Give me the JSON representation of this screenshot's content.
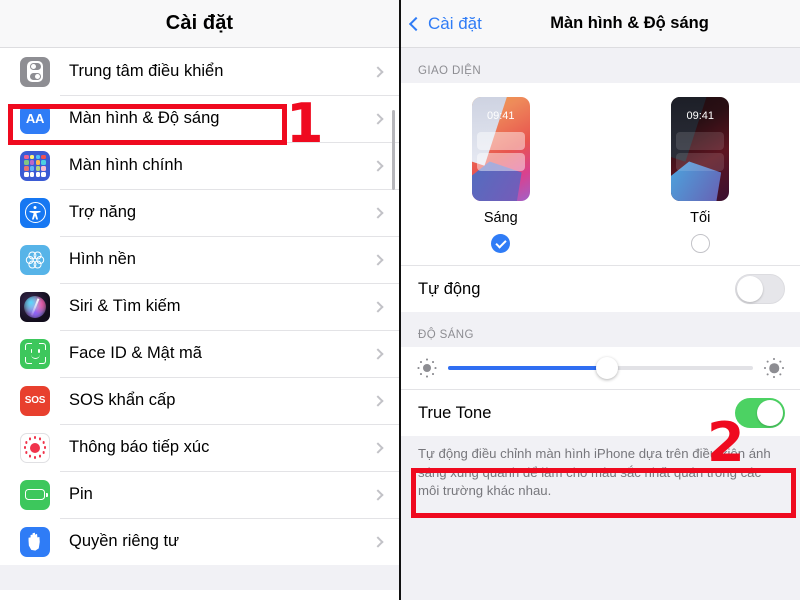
{
  "left": {
    "header_title": "Cài đặt",
    "items": [
      {
        "label": "Trung tâm điều khiển",
        "icon": "control-center-icon"
      },
      {
        "label": "Màn hình & Độ sáng",
        "icon": "display-brightness-icon"
      },
      {
        "label": "Màn hình chính",
        "icon": "home-screen-icon"
      },
      {
        "label": "Trợ năng",
        "icon": "accessibility-icon"
      },
      {
        "label": "Hình nền",
        "icon": "wallpaper-icon"
      },
      {
        "label": "Siri & Tìm kiếm",
        "icon": "siri-icon"
      },
      {
        "label": "Face ID & Mật mã",
        "icon": "face-id-icon"
      },
      {
        "label": "SOS khẩn cấp",
        "icon": "emergency-sos-icon"
      },
      {
        "label": "Thông báo tiếp xúc",
        "icon": "exposure-notification-icon"
      },
      {
        "label": "Pin",
        "icon": "battery-icon"
      },
      {
        "label": "Quyền riêng tư",
        "icon": "privacy-icon"
      }
    ],
    "sos_icon_text": "SOS",
    "display_icon_text": "AA"
  },
  "right": {
    "back_label": "Cài đặt",
    "title": "Màn hình & Độ sáng",
    "appearance_section_header": "GIAO DIỆN",
    "appearance": {
      "light": {
        "name": "Sáng",
        "time": "09:41",
        "selected": true
      },
      "dark": {
        "name": "Tối",
        "time": "09:41",
        "selected": false
      }
    },
    "auto_row": {
      "label": "Tự động",
      "enabled": false
    },
    "brightness_section_header": "ĐỘ SÁNG",
    "brightness": {
      "value_percent": 52
    },
    "true_tone": {
      "label": "True Tone",
      "enabled": true
    },
    "footnote": "Tự động điều chỉnh màn hình iPhone dựa trên điều kiện ánh sáng xung quanh để làm cho màu sắc nhất quán trong các môi trường khác nhau."
  },
  "annotations": {
    "step_one": "1",
    "step_two": "2",
    "highlight_color": "#ef0a1f"
  }
}
